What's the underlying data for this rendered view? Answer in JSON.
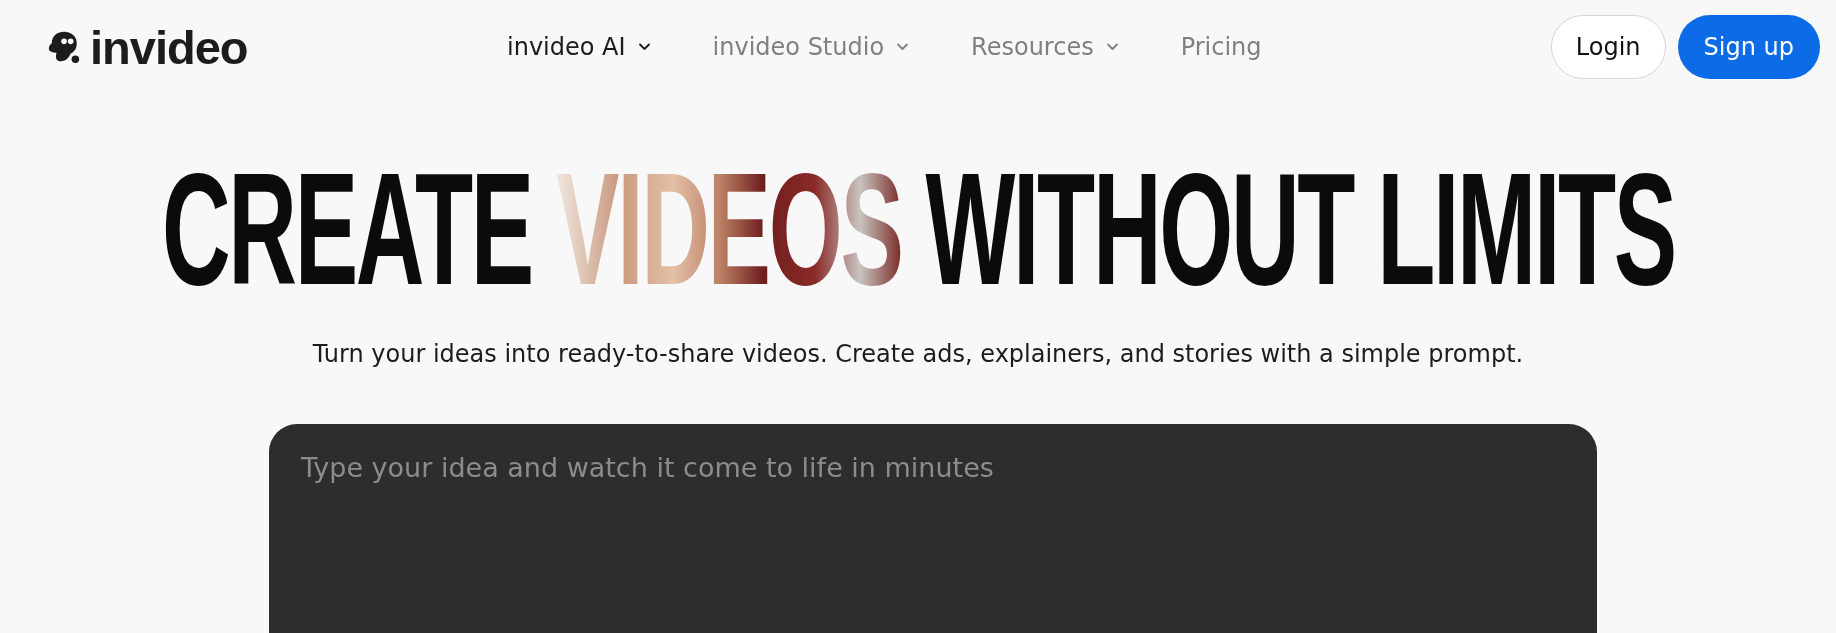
{
  "brand": {
    "name": "invideo"
  },
  "nav": [
    {
      "label": "invideo AI",
      "has_menu": true,
      "selected": true
    },
    {
      "label": "invideo Studio",
      "has_menu": true,
      "selected": false
    },
    {
      "label": "Resources",
      "has_menu": true,
      "selected": false
    },
    {
      "label": "Pricing",
      "has_menu": false,
      "selected": false
    }
  ],
  "actions": [
    {
      "label": "Login",
      "kind": "outline"
    },
    {
      "label": "Sign up",
      "kind": "primary"
    }
  ],
  "headline": {
    "before": "CREATE",
    "highlight": "VIDEOS",
    "after": "WITHOUT LIMITS"
  },
  "subtitle": "Turn your ideas into ready-to-share videos. Create ads, explainers, and stories with a simple prompt.",
  "prompt": {
    "placeholder": "Type your idea and watch it come to life in minutes"
  }
}
